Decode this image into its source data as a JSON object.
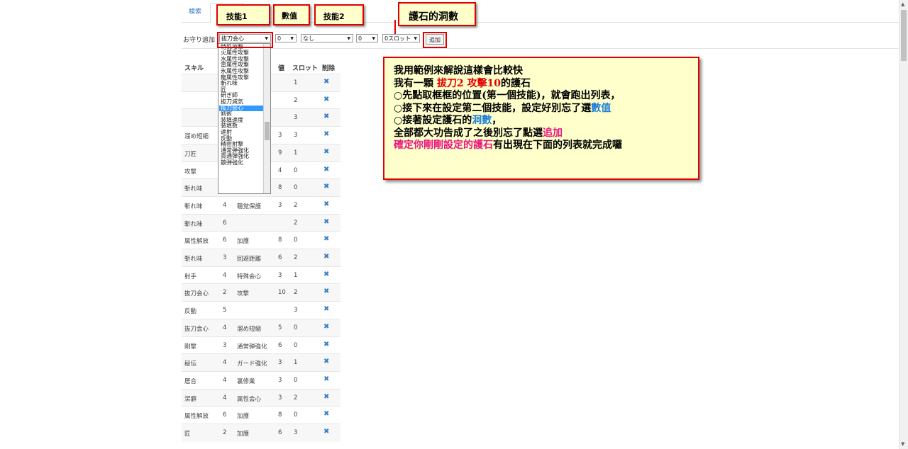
{
  "tabs": [
    "検索"
  ],
  "form": {
    "label": "お守り追加",
    "skill1_value": "抜刀会心",
    "value1": "0",
    "skill2_value": "なし",
    "value2": "0",
    "slot_value": "0スロット",
    "add_label": "追加"
  },
  "table": {
    "headers": [
      "スキル",
      "値",
      "スロット",
      "削除"
    ],
    "rows": [
      [
        "",
        "",
        "",
        "",
        "",
        "1"
      ],
      [
        "",
        "",
        "",
        "",
        "",
        "2"
      ],
      [
        "",
        "",
        "",
        "",
        "",
        "3"
      ],
      [
        "溜め短縮",
        "",
        "",
        "",
        "3",
        "3"
      ],
      [
        "刀匠",
        "",
        "",
        "",
        "9",
        "1"
      ],
      [
        "攻撃",
        "",
        "",
        "",
        "4",
        "0"
      ],
      [
        "斬れ味",
        "",
        "",
        "",
        "8",
        "0"
      ],
      [
        "斬れ味",
        "4",
        "聴覚保護",
        "",
        "3",
        "2"
      ],
      [
        "斬れ味",
        "6",
        "",
        "",
        "",
        "2"
      ],
      [
        "属性解放",
        "6",
        "加護",
        "",
        "8",
        "0"
      ],
      [
        "斬れ味",
        "3",
        "回避距離",
        "",
        "6",
        "2"
      ],
      [
        "射手",
        "4",
        "特殊会心",
        "",
        "3",
        "1"
      ],
      [
        "抜刀会心",
        "2",
        "攻撃",
        "",
        "10",
        "2"
      ],
      [
        "反動",
        "5",
        "",
        "",
        "",
        "3"
      ],
      [
        "抜刀会心",
        "4",
        "溜め短縮",
        "",
        "5",
        "0"
      ],
      [
        "剛撃",
        "3",
        "通常弾強化",
        "",
        "6",
        "0"
      ],
      [
        "秘伝",
        "4",
        "ガード強化",
        "",
        "3",
        "1"
      ],
      [
        "居合",
        "4",
        "裏修業",
        "",
        "3",
        "0"
      ],
      [
        "潔癖",
        "4",
        "属性会心",
        "",
        "3",
        "2"
      ],
      [
        "属性解放",
        "6",
        "加護",
        "",
        "8",
        "0"
      ],
      [
        "匠",
        "2",
        "加護",
        "",
        "6",
        "3"
      ]
    ],
    "delete_glyph": "✖"
  },
  "dropdown": {
    "items": [
      "特殊攻撃",
      "火属性攻撃",
      "水属性攻撃",
      "雷属性攻撃",
      "氷属性攻撃",
      "龍属性攻撃",
      "斬れ味",
      "匠",
      "研ぎ師",
      "抜刀減気",
      "抜刀会心",
      "剣術",
      "装填速度",
      "装填数",
      "速射",
      "反動",
      "精密射撃",
      "通常弾強化",
      "貫通弾強化",
      "散弾強化"
    ],
    "highlighted": "抜刀会心"
  },
  "callouts": {
    "skill1": "技能1",
    "value": "數值",
    "skill2": "技能2",
    "slots": "護石的洞數"
  },
  "explain": {
    "line1": "我用範例來解說這樣會比較快",
    "line2_a": "我有一顆 ",
    "line2_b": "拔刀2 攻擊10",
    "line2_c": "的護石",
    "line3": "○先點取框框的位置(第一個技能)，就會跑出列表，",
    "line4_a": "○接下來在設定第二個技能，設定好別忘了選",
    "line4_b": "數值",
    "line5_a": "○接著設定護石的",
    "line5_b": "洞數",
    "line5_c": "，",
    "line6_a": "全部都大功告成了之後別忘了點選",
    "line6_b": "追加",
    "line7_a": "確定你剛剛設定的護石",
    "line7_b": "有出現在下面的列表就完成囉"
  },
  "colors": {
    "callout_border": "#e00000",
    "callout_bg": "#ffffcc",
    "delete_icon": "#3a7ec2",
    "highlight": "#3399ff",
    "blue_text": "#1c7fd6",
    "pink_text": "#e8157f"
  }
}
